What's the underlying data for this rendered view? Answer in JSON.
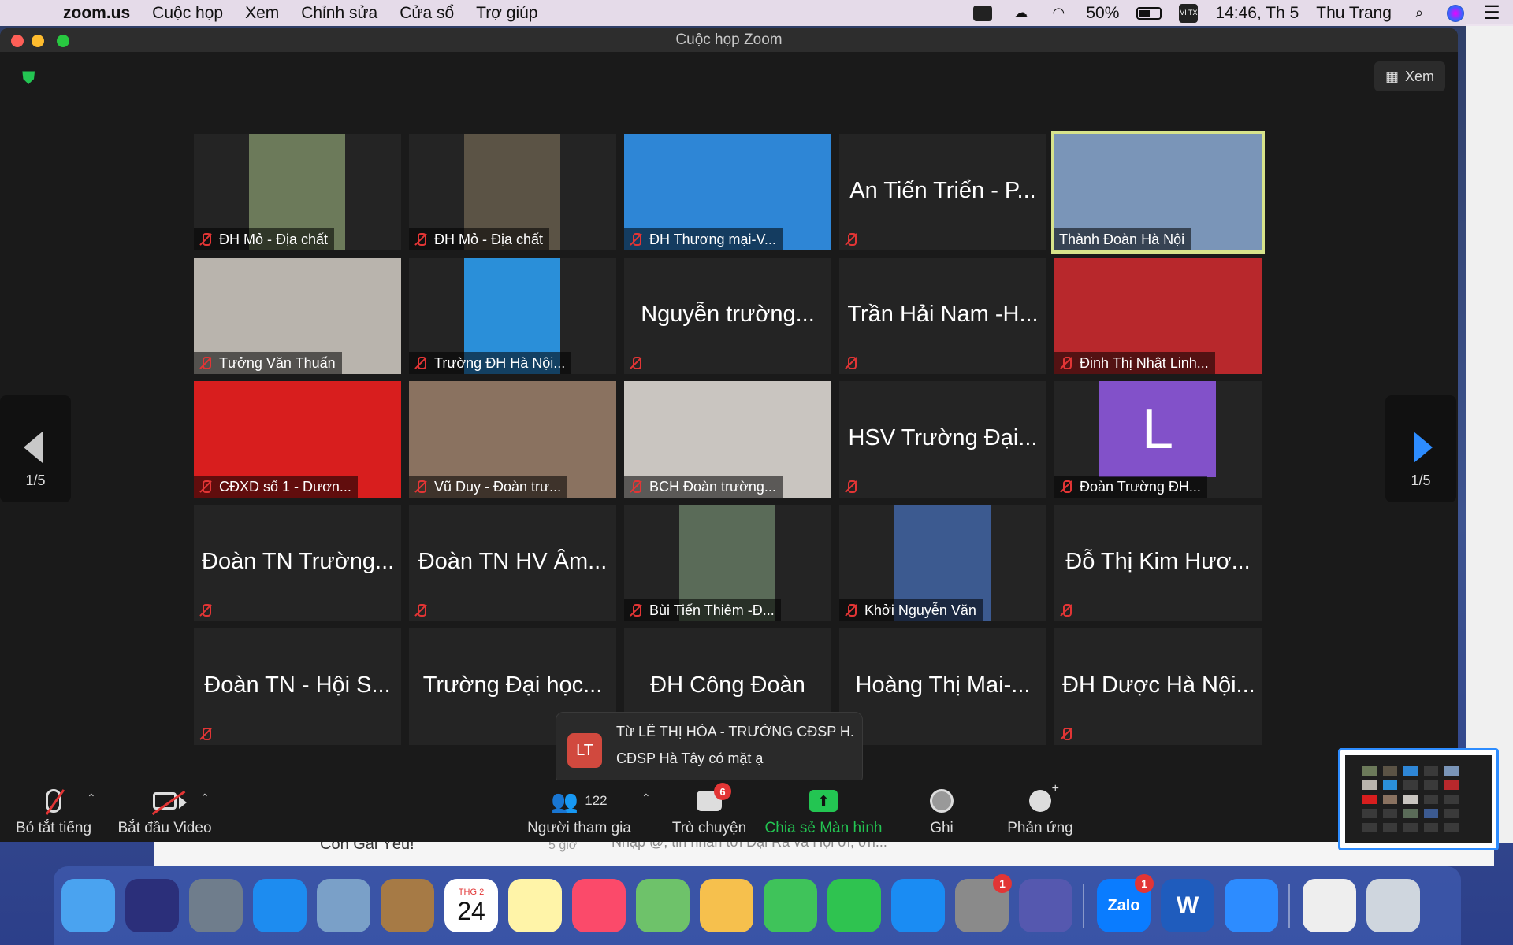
{
  "menubar": {
    "app": "zoom.us",
    "items": [
      "Cuộc họp",
      "Xem",
      "Chỉnh sửa",
      "Cửa sổ",
      "Trợ giúp"
    ],
    "battery": "50%",
    "input_method": "VI TX",
    "clock": "14:46, Th 5",
    "user": "Thu Trang"
  },
  "window": {
    "title": "Cuộc họp Zoom",
    "view_label": "Xem"
  },
  "nav": {
    "left_page": "1/5",
    "right_page": "1/5"
  },
  "tiles": [
    {
      "name": "ĐH Mỏ - Địa chất",
      "type": "video",
      "muted": true,
      "bg": "#6c7a5a"
    },
    {
      "name": "ĐH Mỏ - Địa chất",
      "type": "video",
      "muted": true,
      "bg": "#5b5345"
    },
    {
      "name": "ĐH Thương mại-V...",
      "type": "video",
      "muted": true,
      "bg": "#2e86d6"
    },
    {
      "name": "An Tiến Triển - P...",
      "type": "name",
      "muted": true
    },
    {
      "name": "Thành Đoàn Hà Nội",
      "type": "video",
      "muted": false,
      "bg": "#7a95b8",
      "active": true
    },
    {
      "name": "Tưởng Văn Thuấn",
      "type": "video",
      "muted": true,
      "bg": "#b9b4ad"
    },
    {
      "name": "Trường ĐH Hà Nội...",
      "type": "video",
      "muted": true,
      "bg": "#2a8fd9"
    },
    {
      "name": "Nguyễn  trường...",
      "type": "name",
      "muted": true
    },
    {
      "name": "Trần Hải Nam -H...",
      "type": "name",
      "muted": true
    },
    {
      "name": "Đinh Thị Nhật Linh...",
      "type": "video",
      "muted": true,
      "bg": "#b8282c"
    },
    {
      "name": "CĐXD số 1 - Dươn...",
      "type": "video",
      "muted": true,
      "bg": "#d81e1e"
    },
    {
      "name": "Vũ Duy - Đoàn trư...",
      "type": "video",
      "muted": true,
      "bg": "#8a7260"
    },
    {
      "name": "BCH Đoàn trường...",
      "type": "video",
      "muted": true,
      "bg": "#c9c5c0"
    },
    {
      "name": "HSV Trường Đại...",
      "type": "name",
      "muted": true
    },
    {
      "name": "Đoàn Trường ĐH...",
      "type": "avatar",
      "muted": true,
      "letter": "L"
    },
    {
      "name": "Đoàn TN Trường...",
      "type": "name",
      "muted": true
    },
    {
      "name": "Đoàn TN HV Âm...",
      "type": "name",
      "muted": true
    },
    {
      "name": "Bùi Tiến Thiêm -Đ...",
      "type": "video",
      "muted": true,
      "bg": "#5a6b58"
    },
    {
      "name": "Khởi Nguyễn Văn",
      "type": "video",
      "muted": true,
      "bg": "#3c5a90"
    },
    {
      "name": "Đỗ Thị Kim Hươ...",
      "type": "name",
      "muted": true
    },
    {
      "name": "Đoàn TN - Hội S...",
      "type": "name",
      "muted": true
    },
    {
      "name": "Trường Đại học...",
      "type": "name",
      "muted": false
    },
    {
      "name": "ĐH Công Đoàn",
      "type": "name",
      "muted": false
    },
    {
      "name": "Hoàng Thị Mai-...",
      "type": "name",
      "muted": false
    },
    {
      "name": "ĐH Dược Hà Nội...",
      "type": "name",
      "muted": true
    }
  ],
  "chat_popup": {
    "initials": "LT",
    "from": "Từ LÊ THỊ HÒA - TRƯỜNG CĐSP H...",
    "message": "CĐSP Hà Tây có mặt ạ"
  },
  "toolbar": {
    "mute_label": "Bỏ tắt tiếng",
    "video_label": "Bắt đầu Video",
    "participants_label": "Người tham gia",
    "participants_count": "122",
    "chat_label": "Trò chuyện",
    "chat_badge": "6",
    "share_label": "Chia sẻ Màn hình",
    "record_label": "Ghi",
    "reactions_label": "Phản ứng"
  },
  "background_window": {
    "contact": "Con Gái Yêu!",
    "time": "5 giờ",
    "message": "Nhập @, tin nhắn tới Đại Rà và Hội ơi, ơn..."
  },
  "dock": {
    "calendar_month": "THG 2",
    "calendar_day": "24",
    "items": [
      {
        "name": "finder-icon",
        "color": "#4aa3f0"
      },
      {
        "name": "siri-icon",
        "color": "#2b2f7a"
      },
      {
        "name": "launchpad-icon",
        "color": "#6f7d8c"
      },
      {
        "name": "safari-icon",
        "color": "#1d8cf0"
      },
      {
        "name": "mail-stamp-icon",
        "color": "#7aa0c8"
      },
      {
        "name": "contacts-icon",
        "color": "#a67a45"
      },
      {
        "name": "calendar-icon",
        "color": "#ffffff"
      },
      {
        "name": "notes-icon",
        "color": "#fff4a8"
      },
      {
        "name": "music-icon",
        "color": "#fb4a6a"
      },
      {
        "name": "maps-icon",
        "color": "#6ec26a"
      },
      {
        "name": "photos-icon",
        "color": "#f6c04d"
      },
      {
        "name": "messages-icon",
        "color": "#3fc35a"
      },
      {
        "name": "facetime-icon",
        "color": "#2fc350"
      },
      {
        "name": "appstore-icon",
        "color": "#1a8cf3"
      },
      {
        "name": "system-preferences-icon",
        "color": "#8a8a8a",
        "badge": "1"
      },
      {
        "name": "teams-icon",
        "color": "#5558af"
      },
      {
        "name": "zalo-icon",
        "color": "#0a7cff",
        "badge": "1",
        "text": "Zalo"
      },
      {
        "name": "word-icon",
        "color": "#1f5cbd",
        "text": "W"
      },
      {
        "name": "zoom-icon",
        "color": "#2d8cff"
      },
      {
        "name": "document-icon",
        "color": "#eeeeee"
      },
      {
        "name": "trash-icon",
        "color": "#cfd6de"
      }
    ]
  }
}
